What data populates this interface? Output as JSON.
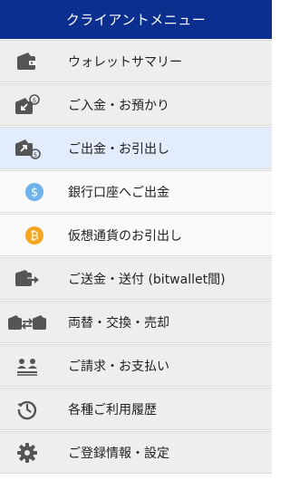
{
  "colors": {
    "header_bg": "#0b2f8f",
    "item_bg": "#eeeeee",
    "active_bg": "#e3ecfb",
    "sub_bg": "#fafafa",
    "icon": "#555555",
    "usd_coin": "#6fb3ea",
    "btc_coin": "#f4a623"
  },
  "header": {
    "title": "クライアントメニュー"
  },
  "items": [
    {
      "label": "ウォレットサマリー",
      "icon": "wallet-icon"
    },
    {
      "label": "ご入金・お預かり",
      "icon": "deposit-icon"
    },
    {
      "label": "ご出金・お引出し",
      "icon": "withdraw-icon",
      "active": true
    },
    {
      "label": "銀行口座へご出金",
      "icon": "dollar-coin-icon",
      "sub": true
    },
    {
      "label": "仮想通貨のお引出し",
      "icon": "bitcoin-coin-icon",
      "sub": true
    },
    {
      "label": "ご送金・送付 (bitwallet間)",
      "icon": "transfer-icon"
    },
    {
      "label": "両替・交換・売却",
      "icon": "exchange-icon"
    },
    {
      "label": "ご請求・お支払い",
      "icon": "request-icon"
    },
    {
      "label": "各種ご利用履歴",
      "icon": "history-icon"
    },
    {
      "label": "ご登録情報・設定",
      "icon": "gear-icon"
    }
  ]
}
